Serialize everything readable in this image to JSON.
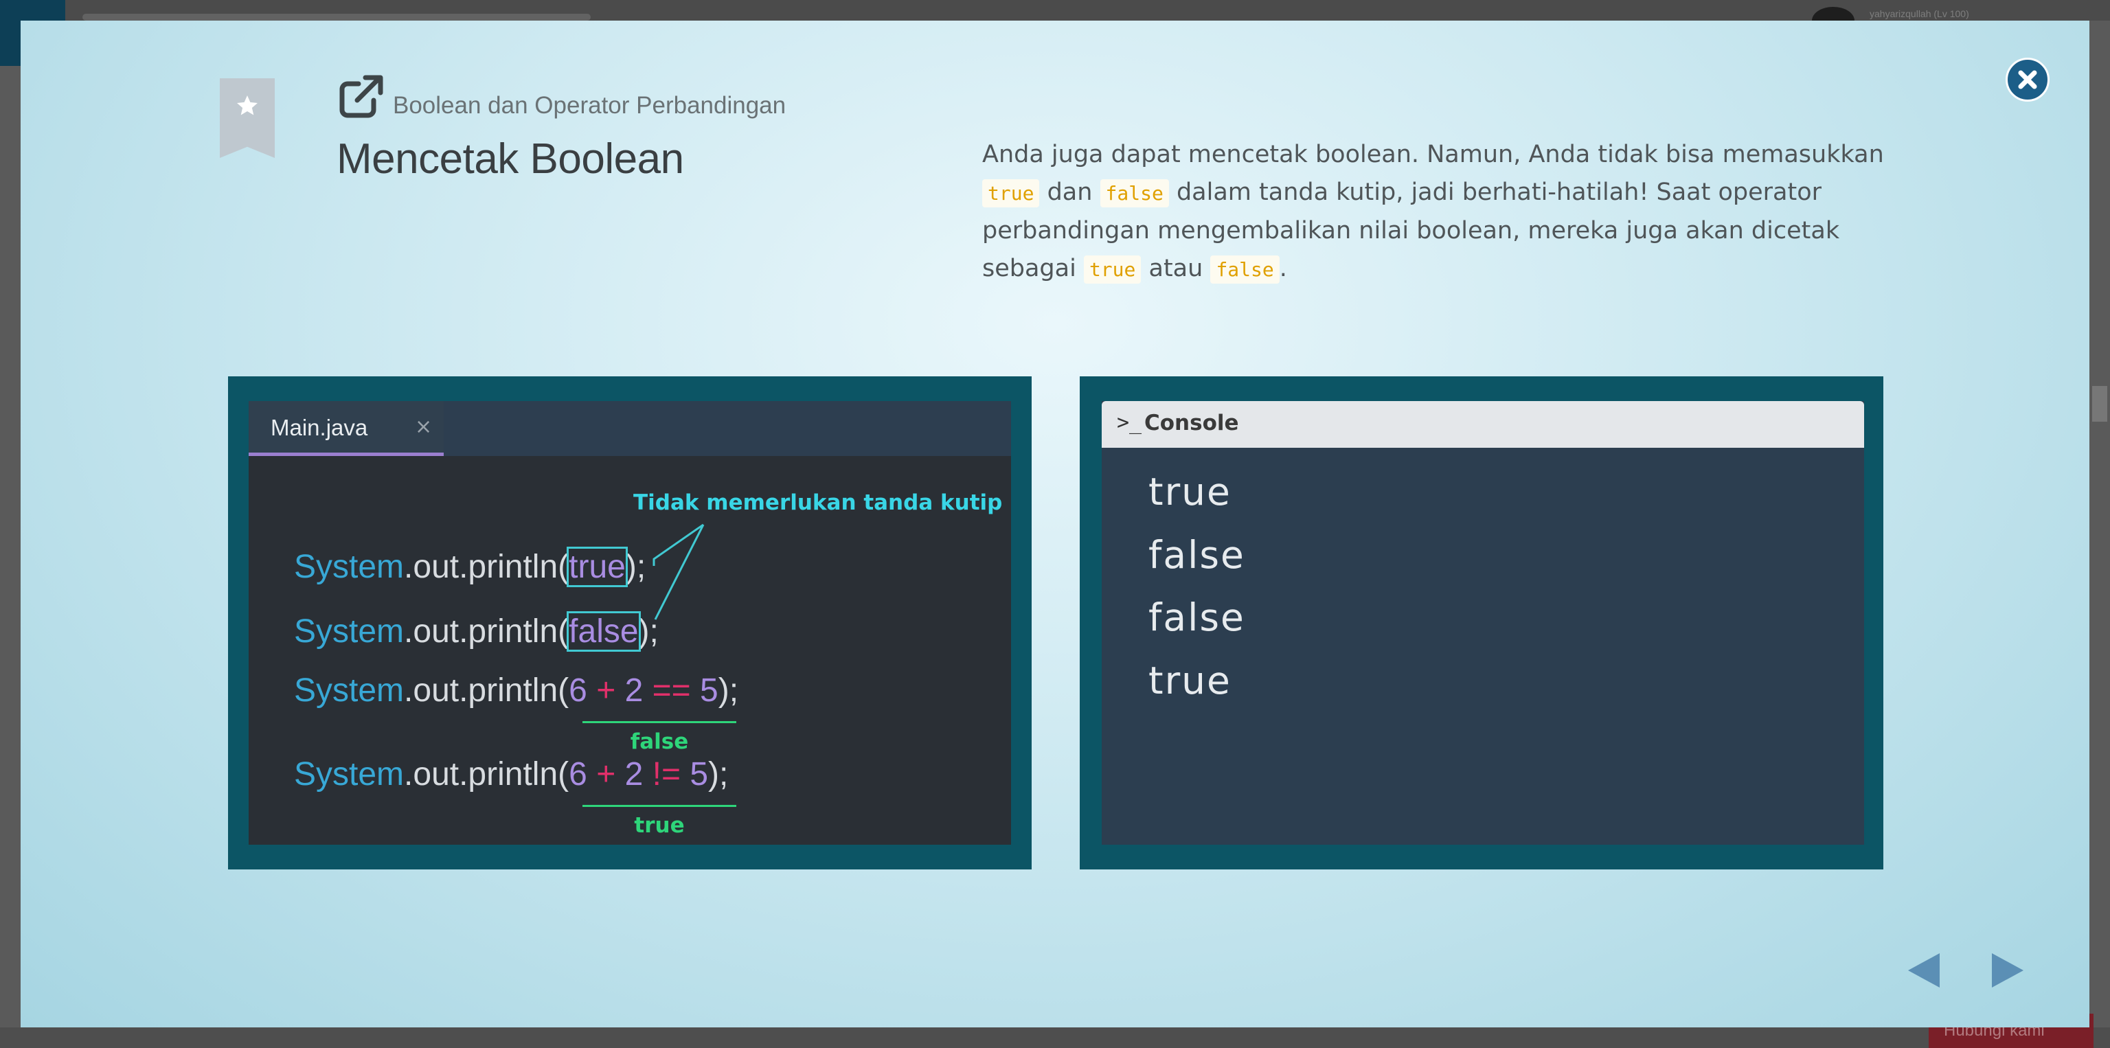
{
  "background": {
    "username": "yahyarizqullah (Lv 100)",
    "help_label": "Hubungi kami"
  },
  "lesson": {
    "category": "Boolean dan Operator Perbandingan",
    "title": "Mencetak Boolean",
    "description": {
      "part1": "Anda juga dapat mencetak boolean. Namun, Anda tidak bisa memasukkan ",
      "code1": "true",
      "part2": " dan ",
      "code2": "false",
      "part3": " dalam tanda kutip, jadi berhati-hatilah! Saat operator perbandingan mengembalikan nilai boolean, mereka juga akan dicetak sebagai ",
      "code3": "true",
      "part4": " atau ",
      "code4": "false",
      "part5": "."
    }
  },
  "editor": {
    "tab_label": "Main.java",
    "tab_close": "×",
    "annotation": "Tidak memerlukan tanda kutip",
    "code_lines": [
      {
        "sys": "System",
        "mid": ".out.println(",
        "arg": "true",
        "end": ");"
      },
      {
        "sys": "System",
        "mid": ".out.println(",
        "arg": "false",
        "end": ");"
      },
      {
        "sys": "System",
        "mid": ".out.println(",
        "a": "6",
        "op1": " + ",
        "b": "2",
        "op2": " == ",
        "c": "5",
        "end": ");",
        "result": "false"
      },
      {
        "sys": "System",
        "mid": ".out.println(",
        "a": "6",
        "op1": " + ",
        "b": "2",
        "op2": " != ",
        "c": "5",
        "end": ");",
        "result": "true"
      }
    ]
  },
  "console": {
    "prompt": ">_",
    "label": "Console",
    "output": [
      "true",
      "false",
      "false",
      "true"
    ]
  },
  "colors": {
    "panel": "#0c5565",
    "accent": "#1c5e88",
    "code_literal": "#a98de2",
    "code_system": "#38a8d6",
    "operator": "#e0306a",
    "result_green": "#2ed57a",
    "annotation_cyan": "#39d6e6"
  },
  "icons": {
    "bookmark": "bookmark-star-icon",
    "external": "external-link-icon",
    "close": "close-icon",
    "prev": "triangle-left-icon",
    "next": "triangle-right-icon"
  }
}
